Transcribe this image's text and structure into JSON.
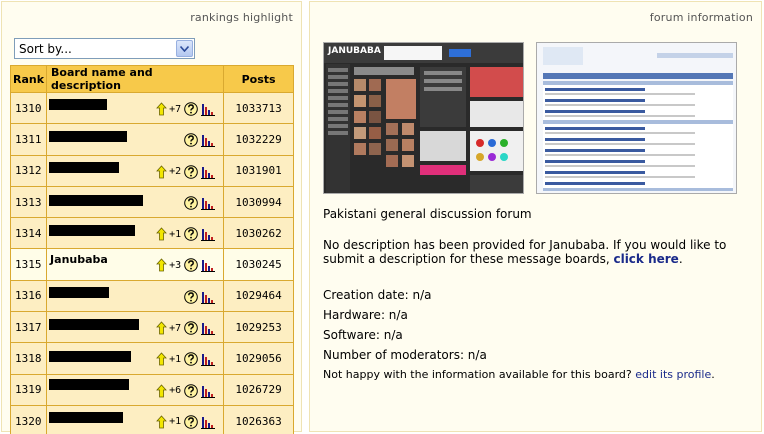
{
  "left": {
    "title": "rankings highlight",
    "sort": {
      "selected": "Sort by..."
    },
    "headers": {
      "rank": "Rank",
      "board": "Board name and description",
      "posts": "Posts"
    },
    "rows": [
      {
        "rank": "1310",
        "name": "",
        "change": "+7",
        "posts": "1033713"
      },
      {
        "rank": "1311",
        "name": "",
        "change": "",
        "posts": "1032229"
      },
      {
        "rank": "1312",
        "name": "",
        "change": "+2",
        "posts": "1031901"
      },
      {
        "rank": "1313",
        "name": "",
        "change": "",
        "posts": "1030994"
      },
      {
        "rank": "1314",
        "name": "",
        "change": "+1",
        "posts": "1030262"
      },
      {
        "rank": "1315",
        "name": "Janubaba",
        "change": "+3",
        "posts": "1030245"
      },
      {
        "rank": "1316",
        "name": "",
        "change": "",
        "posts": "1029464"
      },
      {
        "rank": "1317",
        "name": "",
        "change": "+7",
        "posts": "1029253"
      },
      {
        "rank": "1318",
        "name": "",
        "change": "+1",
        "posts": "1029056"
      },
      {
        "rank": "1319",
        "name": "",
        "change": "+6",
        "posts": "1026729"
      },
      {
        "rank": "1320",
        "name": "",
        "change": "+1",
        "posts": "1026363"
      }
    ]
  },
  "right": {
    "title": "forum information",
    "shot1_logo": "JANUBABA",
    "description_line": "Pakistani general discussion forum",
    "no_desc_text": "No description has been provided for Janubaba. If you would like to submit a description for these message boards,",
    "no_desc_link": "click here",
    "no_desc_end": ".",
    "creation": "Creation date: n/a",
    "hardware": "Hardware: n/a",
    "software": "Software: n/a",
    "moderators": "Number of moderators: n/a",
    "not_happy": "Not happy with the information available for this board?",
    "edit_link": "edit its profile",
    "edit_end": "."
  },
  "colors": {
    "header_bg": "#f7c94a",
    "row_bg": "#fdeec2",
    "highlight_row_bg": "#fffde8",
    "link": "#1a2a8a",
    "up_arrow": "#e8d800"
  },
  "icons": [
    "chevron-down-icon",
    "up-arrow-icon",
    "help-icon",
    "stats-icon"
  ]
}
